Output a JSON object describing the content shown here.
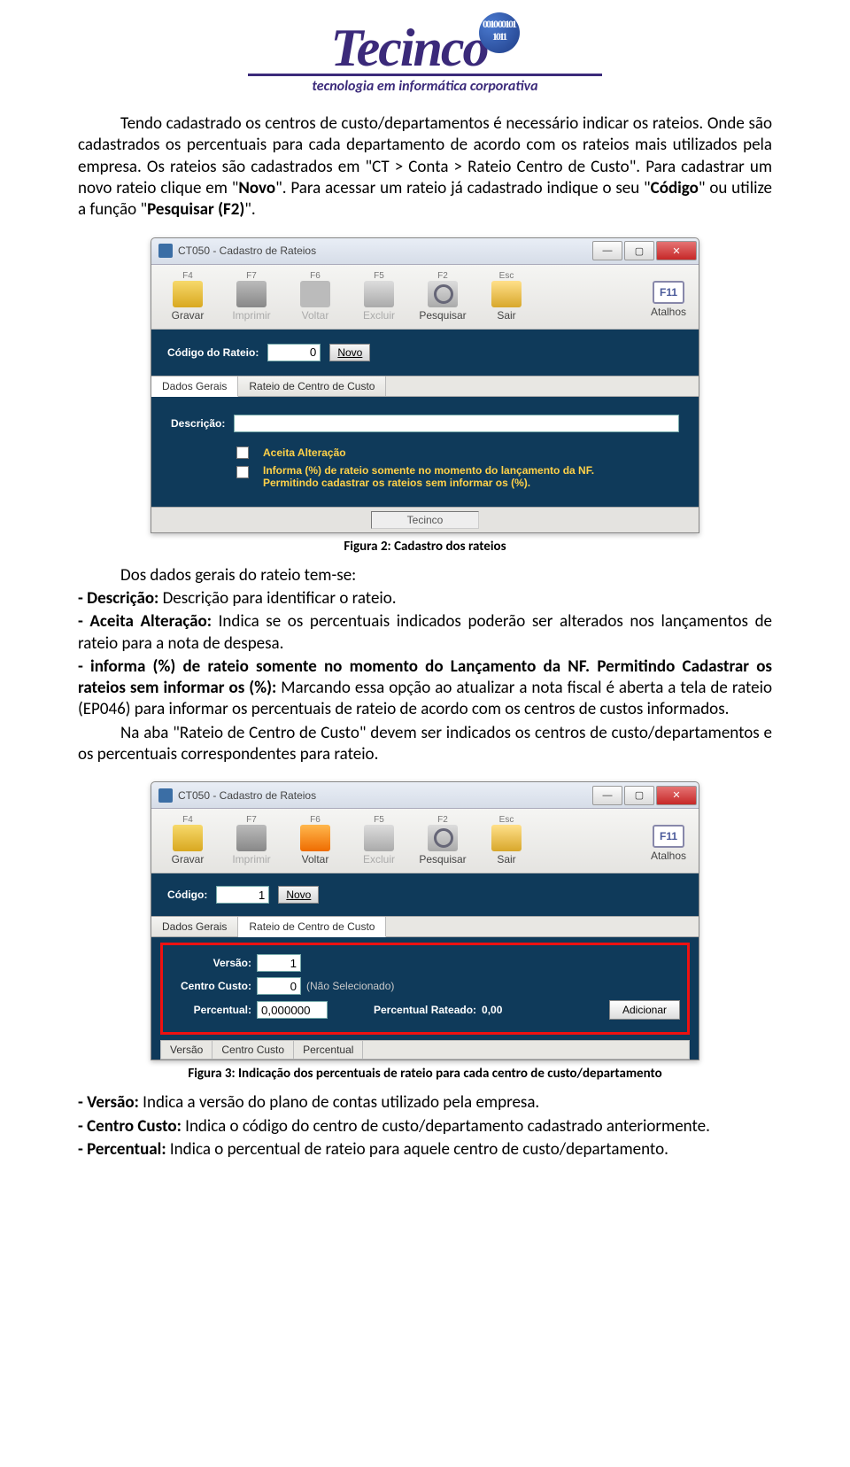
{
  "logo": {
    "brand": "Tecinco",
    "tag": "tecnologia em informática corporativa",
    "bits": "0010\n00101\n1011"
  },
  "para1_a": "Tendo cadastrado os centros de custo/departamentos é necessário indicar os rateios. Onde são cadastrados os percentuais para cada departamento de acordo com os rateios mais utilizados pela empresa. Os rateios são cadastrados em \"CT > Conta > Rateio Centro de Custo\". Para cadastrar um novo rateio clique em \"",
  "para1_b": "Novo",
  "para1_c": "\". Para acessar um rateio já cadastrado indique o seu \"",
  "para1_d": "Código",
  "para1_e": "\" ou utilize a função \"",
  "para1_f": "Pesquisar (F2)",
  "para1_g": "\".",
  "win1": {
    "title": "CT050 - Cadastro de Rateios",
    "toolbar": [
      {
        "fkey": "F4",
        "label": "Gravar",
        "icon": "ic-save",
        "disabled": false
      },
      {
        "fkey": "F7",
        "label": "Imprimir",
        "icon": "ic-print",
        "disabled": true
      },
      {
        "fkey": "F6",
        "label": "Voltar",
        "icon": "ic-back",
        "disabled": true
      },
      {
        "fkey": "F5",
        "label": "Excluir",
        "icon": "ic-del",
        "disabled": true
      },
      {
        "fkey": "F2",
        "label": "Pesquisar",
        "icon": "ic-search",
        "disabled": false
      },
      {
        "fkey": "Esc",
        "label": "Sair",
        "icon": "ic-exit",
        "disabled": false
      }
    ],
    "atalhos": "Atalhos",
    "f11": "F11",
    "codigo_lbl": "Código do Rateio:",
    "codigo_val": "0",
    "novo": "Novo",
    "tab1": "Dados Gerais",
    "tab2": "Rateio de Centro de Custo",
    "desc_lbl": "Descrição:",
    "chk1": "Aceita Alteração",
    "chk2": "Informa (%) de rateio somente no momento do lançamento da NF. Permitindo cadastrar os rateios sem informar os (%).",
    "status": "Tecinco"
  },
  "caption1": "Figura 2: Cadastro dos rateios",
  "p2_a": "Dos dados gerais do rateio tem-se:",
  "p2_b": "- Descrição: ",
  "p2_b2": "Descrição para identificar o rateio.",
  "p2_c": "- Aceita Alteração: ",
  "p2_c2": "Indica se os percentuais indicados poderão ser alterados nos lançamentos de rateio para a nota de despesa.",
  "p2_d": "- informa (%) de rateio somente no momento do Lançamento da NF. Permitindo Cadastrar os rateios sem informar os (%): ",
  "p2_d2": "Marcando essa opção ao atualizar a nota fiscal é aberta a tela de rateio (EP046) para informar os percentuais de rateio de acordo com os centros de custos informados.",
  "p2_e": "Na aba \"Rateio de Centro de Custo\" devem ser indicados os centros de custo/departamentos e os percentuais correspondentes para rateio.",
  "win2": {
    "title": "CT050 - Cadastro de Rateios",
    "toolbar": [
      {
        "fkey": "F4",
        "label": "Gravar",
        "icon": "ic-save",
        "disabled": false
      },
      {
        "fkey": "F7",
        "label": "Imprimir",
        "icon": "ic-print",
        "disabled": true
      },
      {
        "fkey": "F6",
        "label": "Voltar",
        "icon": "ic-back orange",
        "disabled": false
      },
      {
        "fkey": "F5",
        "label": "Excluir",
        "icon": "ic-del",
        "disabled": true
      },
      {
        "fkey": "F2",
        "label": "Pesquisar",
        "icon": "ic-search",
        "disabled": false
      },
      {
        "fkey": "Esc",
        "label": "Sair",
        "icon": "ic-exit",
        "disabled": false
      }
    ],
    "atalhos": "Atalhos",
    "f11": "F11",
    "codigo_lbl": "Código:",
    "codigo_val": "1",
    "novo": "Novo",
    "tab1": "Dados Gerais",
    "tab2": "Rateio de Centro de Custo",
    "versao_lbl": "Versão:",
    "versao_val": "1",
    "cc_lbl": "Centro Custo:",
    "cc_val": "0",
    "cc_hint": "(Não Selecionado)",
    "perc_lbl": "Percentual:",
    "perc_val": "0,000000",
    "percr_lbl": "Percentual Rateado:",
    "percr_val": "0,00",
    "add": "Adicionar",
    "th1": "Versão",
    "th2": "Centro Custo",
    "th3": "Percentual"
  },
  "caption2": "Figura 3: Indicação dos percentuais de rateio para cada centro de custo/departamento",
  "p3_a_lbl": "- Versão: ",
  "p3_a_txt": "Indica a versão do plano de contas utilizado pela empresa.",
  "p3_b_lbl": "- Centro Custo: ",
  "p3_b_txt": "Indica o código do centro de custo/departamento cadastrado anteriormente.",
  "p3_c_lbl": "- Percentual: ",
  "p3_c_txt": "Indica o percentual de rateio para aquele centro de custo/departamento."
}
